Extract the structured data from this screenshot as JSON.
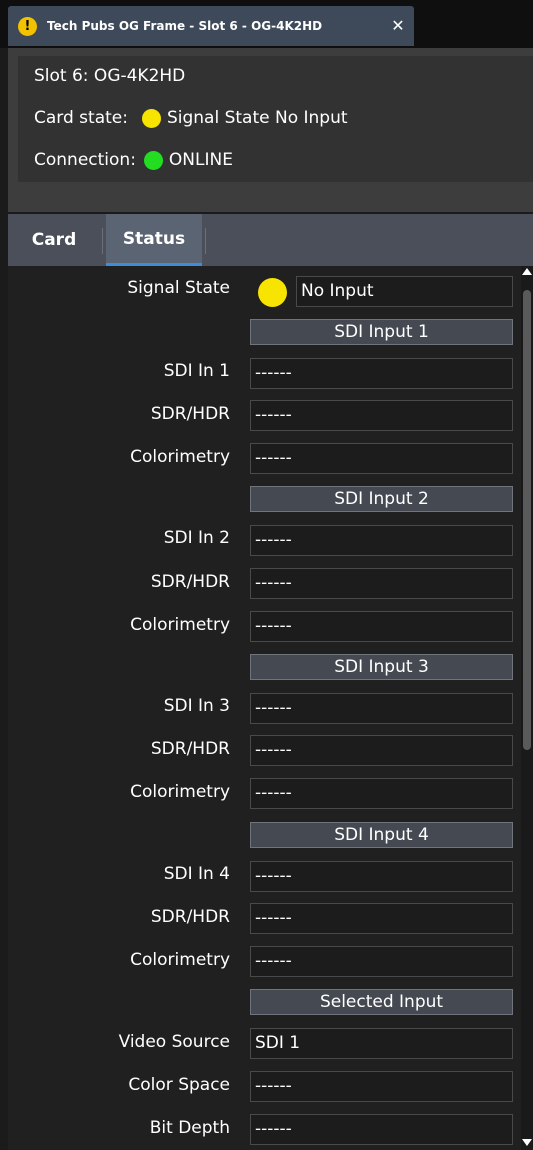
{
  "window": {
    "tab_title": "Tech Pubs OG Frame - Slot 6 - OG-4K2HD",
    "warning_icon": "!",
    "close_icon": "✕"
  },
  "info": {
    "slot": "Slot 6: OG-4K2HD",
    "card_state_label": "Card state:",
    "card_state_value": "Signal State No Input",
    "card_state_color": "#f7e400",
    "connection_label": "Connection:",
    "connection_value": "ONLINE",
    "connection_color": "#22dd22"
  },
  "tabs": [
    {
      "label": "Card",
      "active": false
    },
    {
      "label": "Status",
      "active": true
    }
  ],
  "status": {
    "signal_state_label": "Signal State",
    "signal_state_value": "No Input",
    "signal_state_color": "#f7e400",
    "sections": [
      {
        "header": "SDI Input 1",
        "rows": [
          {
            "label": "SDI In 1",
            "value": "------"
          },
          {
            "label": "SDR/HDR",
            "value": "------"
          },
          {
            "label": "Colorimetry",
            "value": "------"
          }
        ]
      },
      {
        "header": "SDI Input 2",
        "rows": [
          {
            "label": "SDI In 2",
            "value": "------"
          },
          {
            "label": "SDR/HDR",
            "value": "------"
          },
          {
            "label": "Colorimetry",
            "value": "------"
          }
        ]
      },
      {
        "header": "SDI Input 3",
        "rows": [
          {
            "label": "SDI In 3",
            "value": "------"
          },
          {
            "label": "SDR/HDR",
            "value": "------"
          },
          {
            "label": "Colorimetry",
            "value": "------"
          }
        ]
      },
      {
        "header": "SDI Input 4",
        "rows": [
          {
            "label": "SDI In 4",
            "value": "------"
          },
          {
            "label": "SDR/HDR",
            "value": "------"
          },
          {
            "label": "Colorimetry",
            "value": "------"
          }
        ]
      },
      {
        "header": "Selected Input",
        "rows": [
          {
            "label": "Video Source",
            "value": "SDI 1"
          },
          {
            "label": "Color Space",
            "value": "------"
          },
          {
            "label": "Bit Depth",
            "value": "------"
          }
        ]
      }
    ]
  }
}
